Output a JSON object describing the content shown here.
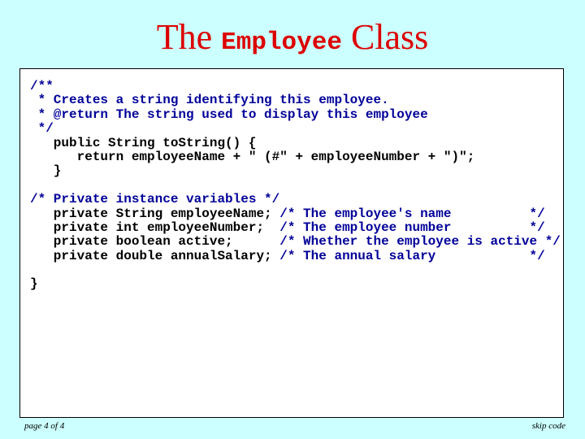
{
  "slide": {
    "title_prefix": "The ",
    "title_code": "Employee",
    "title_suffix": " Class",
    "colors": {
      "background": "#ccffff",
      "title": "#dd0000",
      "comment": "#000099",
      "code": "#000000",
      "box": "#ffffff"
    }
  },
  "code_lines": [
    [
      {
        "t": "/**",
        "c": "cm"
      }
    ],
    [
      {
        "t": " * Creates a string identifying this employee.",
        "c": "cm"
      }
    ],
    [
      {
        "t": " * @return The string used to display this employee",
        "c": "cm"
      }
    ],
    [
      {
        "t": " */",
        "c": "cm"
      }
    ],
    [
      {
        "t": "   public String toString() {",
        "c": "tx"
      }
    ],
    [
      {
        "t": "      return employeeName + \" (#\" + employeeNumber + \")\";",
        "c": "tx"
      }
    ],
    [
      {
        "t": "   }",
        "c": "tx"
      }
    ],
    [
      {
        "t": "",
        "c": "tx"
      }
    ],
    [
      {
        "t": "/* Private instance variables */",
        "c": "cm"
      }
    ],
    [
      {
        "t": "   private String employeeName; ",
        "c": "tx"
      },
      {
        "t": "/* The employee's name          */",
        "c": "cm"
      }
    ],
    [
      {
        "t": "   private int employeeNumber;  ",
        "c": "tx"
      },
      {
        "t": "/* The employee number          */",
        "c": "cm"
      }
    ],
    [
      {
        "t": "   private boolean active;      ",
        "c": "tx"
      },
      {
        "t": "/* Whether the employee is active */",
        "c": "cm"
      }
    ],
    [
      {
        "t": "   private double annualSalary; ",
        "c": "tx"
      },
      {
        "t": "/* The annual salary            */",
        "c": "cm"
      }
    ],
    [
      {
        "t": "",
        "c": "tx"
      }
    ],
    [
      {
        "t": "}",
        "c": "tx"
      }
    ]
  ],
  "footer": {
    "page_label": "page 4 of 4",
    "skip_label": "skip code"
  }
}
